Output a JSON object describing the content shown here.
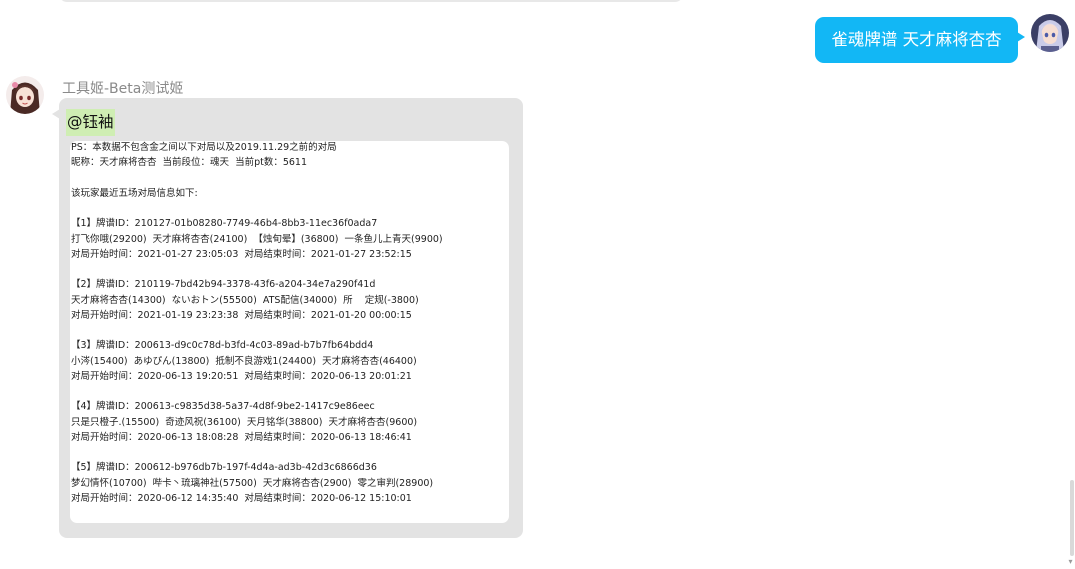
{
  "colors": {
    "user_bubble": "#12b7f5",
    "bot_bubble": "#e3e3e3",
    "mention_highlight": "#cfeeb3",
    "card": "#ffffff"
  },
  "user_message": {
    "avatar_icon": "anime-avatar-silver-hair",
    "text": "雀魂牌谱 天才麻将杏杏"
  },
  "bot_message": {
    "avatar_icon": "anime-avatar-brown-hair",
    "sender": "工具姬-Beta测试姬",
    "mention": "@钰袖",
    "lines": [
      "PS：本数据不包含金之间以下对局以及2019.11.29之前的对局",
      "昵称：天才麻将杏杏  当前段位：魂天  当前pt数：5611",
      "",
      "该玩家最近五场对局信息如下:",
      "",
      "【1】牌谱ID：210127-01b08280-7749-46b4-8bb3-11ec36f0ada7",
      "打飞你哦(29200)  天才麻将杏杏(24100)  【烛旬晕】(36800)  一条鱼儿上青天(9900)",
      "对局开始时间：2021-01-27 23:05:03  对局结束时间：2021-01-27 23:52:15",
      "",
      "【2】牌谱ID：210119-7bd42b94-3378-43f6-a204-34e7a290f41d",
      "天才麻将杏杏(14300)  ないおトン(55500)  ATS配信(34000)  所    定规(-3800)",
      "对局开始时间：2021-01-19 23:23:38  对局结束时间：2021-01-20 00:00:15",
      "",
      "【3】牌谱ID：200613-d9c0c78d-b3fd-4c03-89ad-b7b7fb64bdd4",
      "小涔(15400)  あゆぴん(13800)  抵制不良游戏1(24400)  天才麻将杏杏(46400)",
      "对局开始时间：2020-06-13 19:20:51  对局结束时间：2020-06-13 20:01:21",
      "",
      "【4】牌谱ID：200613-c9835d38-5a37-4d8f-9be2-1417c9e86eec",
      "只是只橙子.(15500)  奇迹风祝(36100)  天月铭华(38800)  天才麻将杏杏(9600)",
      "对局开始时间：2020-06-13 18:08:28  对局结束时间：2020-06-13 18:46:41",
      "",
      "【5】牌谱ID：200612-b976db7b-197f-4d4a-ad3b-42d3c6866d36",
      "梦幻情怀(10700)  哔卡丶琉璃神社(57500)  天才麻将杏杏(2900)  零之审判(28900)",
      "对局开始时间：2020-06-12 14:35:40  对局结束时间：2020-06-12 15:10:01"
    ]
  },
  "scrollbar": {
    "arrow_icon": "scroll-down-arrow-icon",
    "arrow_glyph": "▾"
  }
}
